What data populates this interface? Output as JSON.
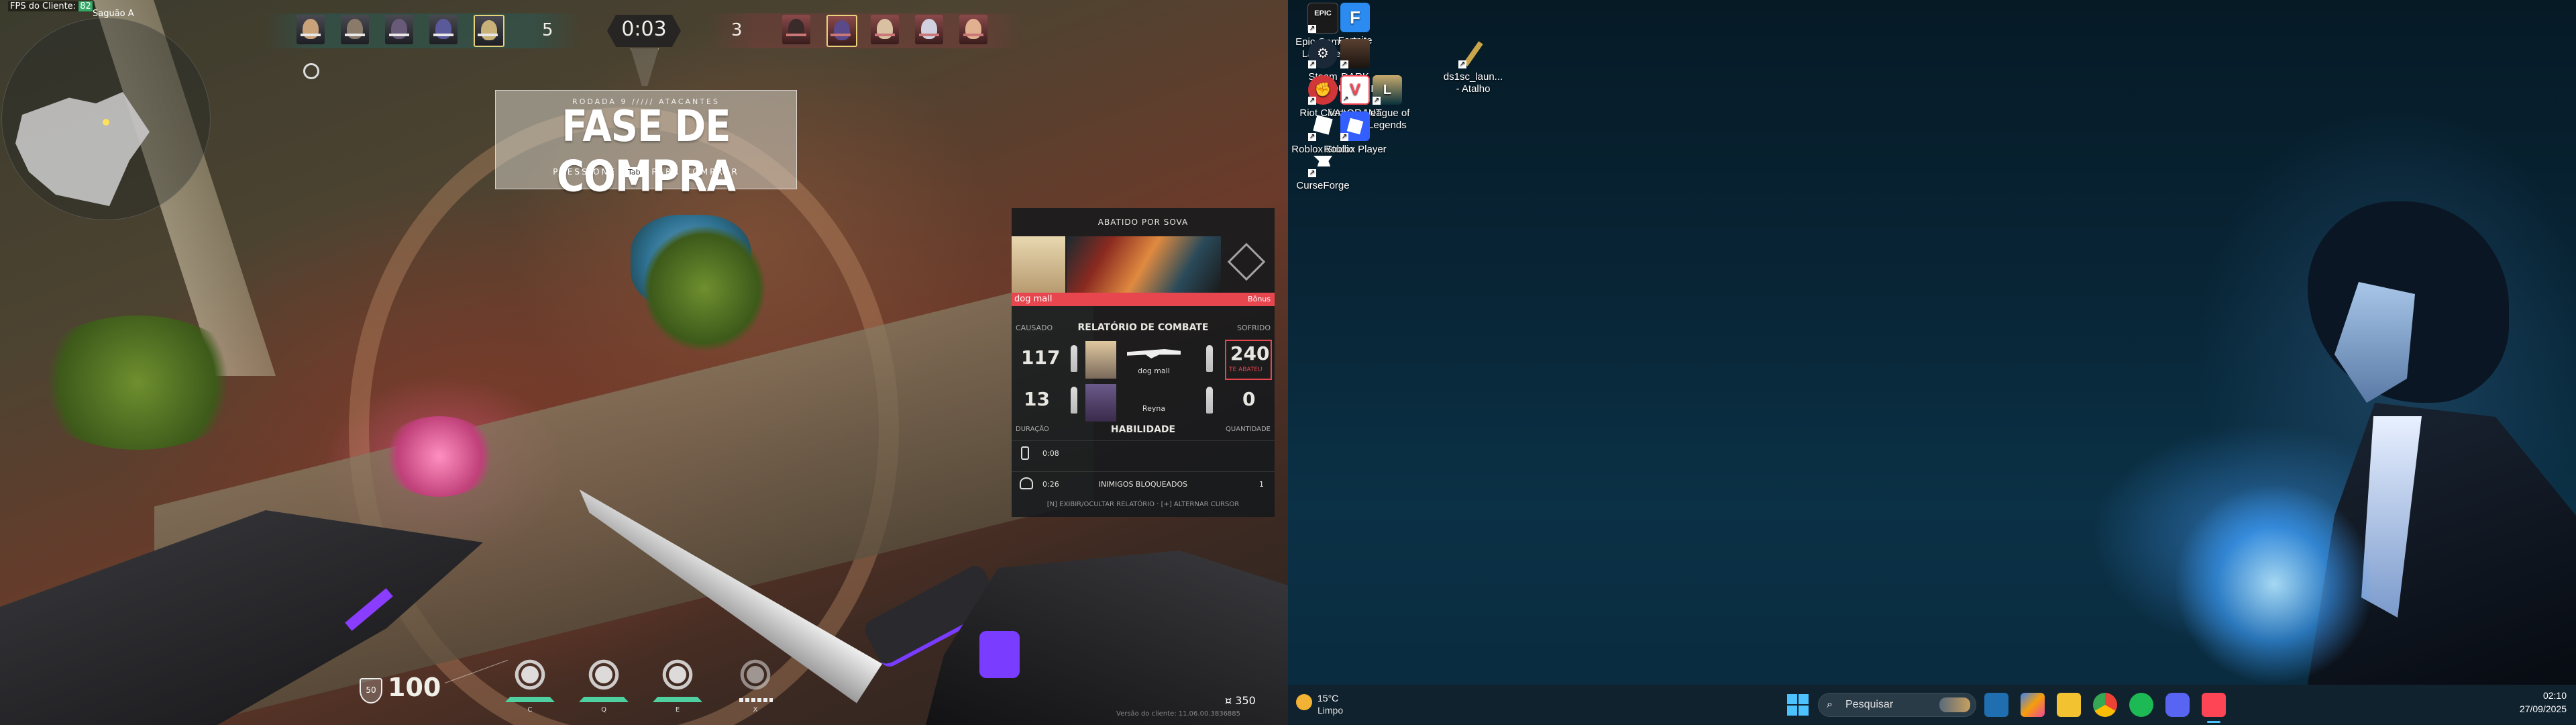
{
  "game": {
    "fps_label": "FPS do Cliente:",
    "fps_value": "82",
    "location": "Saguão A",
    "score_ally": "5",
    "score_enemy": "3",
    "timer": "0:03",
    "round_info": "RODADA 9 ///// ATACANTES",
    "phase_title": "FASE DE COMPRA",
    "press_prefix": "PRESSIONE",
    "press_key": "Tab",
    "press_suffix": "PARA COMPRAR",
    "killfeed": {
      "header": "ABATIDO POR SOVA",
      "killer_name": "dog mall",
      "weapon_tag": "Bônus"
    },
    "combat_report": {
      "caused_label": "CAUSADO",
      "title": "RELATÓRIO DE COMBATE",
      "suffered_label": "SOFRIDO",
      "row1": {
        "dealt": "117",
        "player": "dog mall",
        "received": "240",
        "tag": "TE ABATEU"
      },
      "row2": {
        "dealt": "13",
        "player": "Reyna",
        "received": "0"
      },
      "duration_label": "DURAÇÃO",
      "ability_label": "HABILIDADE",
      "quantity_label": "QUANTIDADE",
      "ability_rows": [
        {
          "time": "0:08",
          "name": "",
          "qty": ""
        },
        {
          "time": "0:26",
          "name": "INIMIGOS BLOQUEADOS",
          "qty": "1"
        }
      ],
      "footer": "[N] EXIBIR/OCULTAR RELATÓRIO · [+] ALTERNAR CURSOR"
    },
    "shield": "50",
    "health": "100",
    "credits": "350",
    "ability_keys": [
      "C",
      "Q",
      "E",
      "X"
    ],
    "version": "Versão do cliente: 11.06.00.3836885"
  },
  "desktop": {
    "icons": [
      {
        "label": "Epic Games Launcher",
        "icon": "epic-games-icon",
        "color": "#1a1a1a"
      },
      {
        "label": "Fortnite",
        "icon": "fortnite-icon",
        "color": "#2b8bf0"
      },
      {
        "label": "Steam",
        "icon": "steam-icon",
        "color": "#1b2838"
      },
      {
        "label": "DARK SOULS™ R...",
        "icon": "dark-souls-icon",
        "color": "#3a2a20"
      },
      {
        "label": "ds1sc_laun... - Atalho",
        "icon": "shortcut-icon",
        "color": "#c9a64a"
      },
      {
        "label": "Riot Client",
        "icon": "riot-client-icon",
        "color": "#d13639"
      },
      {
        "label": "VALORANT",
        "icon": "valorant-icon",
        "color": "#fd4556"
      },
      {
        "label": "League of Legends",
        "icon": "league-of-legends-icon",
        "color": "#c8aa6e"
      },
      {
        "label": "Roblox Studio",
        "icon": "roblox-studio-icon",
        "color": "#ffffff"
      },
      {
        "label": "Roblox Player",
        "icon": "roblox-player-icon",
        "color": "#335fff"
      },
      {
        "label": "CurseForge",
        "icon": "curseforge-icon",
        "color": "#ffffff"
      }
    ],
    "taskbar": {
      "temperature": "15°C",
      "weather": "Limpo",
      "search_placeholder": "Pesquisar",
      "time": "02:10",
      "date": "27/09/2025"
    }
  }
}
